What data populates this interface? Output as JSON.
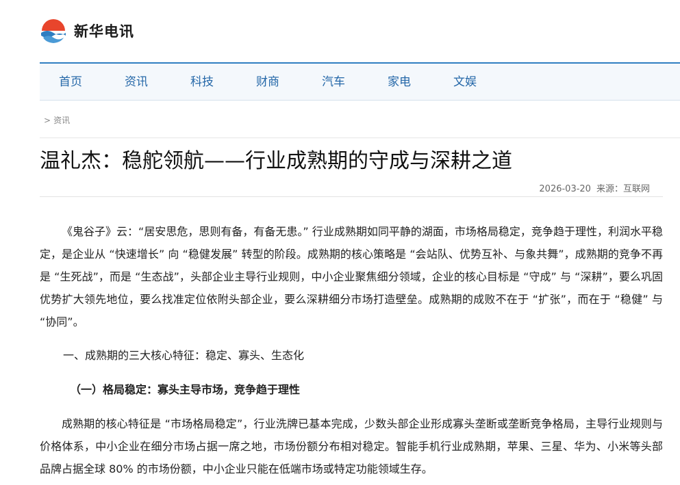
{
  "site": {
    "name": "新华电讯",
    "logo_colors": {
      "top": "#e8452c",
      "wave1": "#2f7ec1",
      "wave2": "#4a9ad6"
    }
  },
  "nav": {
    "items": [
      "首页",
      "资讯",
      "科技",
      "财商",
      "汽车",
      "家电",
      "文娱"
    ]
  },
  "breadcrumb": {
    "separator": ">",
    "current": "资讯"
  },
  "article": {
    "title": "温礼杰：稳舵领航——行业成熟期的守成与深耕之道",
    "date": "2026-03-20",
    "source_label": "来源：",
    "source": "互联网",
    "paragraphs": [
      "《鬼谷子》云：“居安思危，思则有备，有备无患。” 行业成熟期如同平静的湖面，市场格局稳定，竞争趋于理性，利润水平稳定，是企业从 “快速增长” 向 “稳健发展” 转型的阶段。成熟期的核心策略是 “会站队、优势互补、与象共舞”，成熟期的竞争不再是 “生死战”，而是 “生态战”，头部企业主导行业规则，中小企业聚焦细分领域，企业的核心目标是 “守成” 与 “深耕”，要么巩固优势扩大领先地位，要么找准定位依附头部企业，要么深耕细分市场打造壁垒。成熟期的成败不在于 “扩张”，而在于 “稳健” 与 “协同”。",
      "一、成熟期的三大核心特征：稳定、寡头、生态化",
      "（一）格局稳定：寡头主导市场，竞争趋于理性",
      "成熟期的核心特征是 “市场格局稳定”，行业洗牌已基本完成，少数头部企业形成寡头垄断或垄断竞争格局，主导行业规则与价格体系，中小企业在细分市场占据一席之地，市场份额分布相对稳定。智能手机行业成熟期，苹果、三星、华为、小米等头部品牌占据全球 80% 的市场份额，中小企业只能在低端市场或特定功能领域生存。"
    ]
  },
  "colors": {
    "accent": "#2f7ec1",
    "nav_text": "#2467a8",
    "nav_bg": "#f4f8fc"
  }
}
